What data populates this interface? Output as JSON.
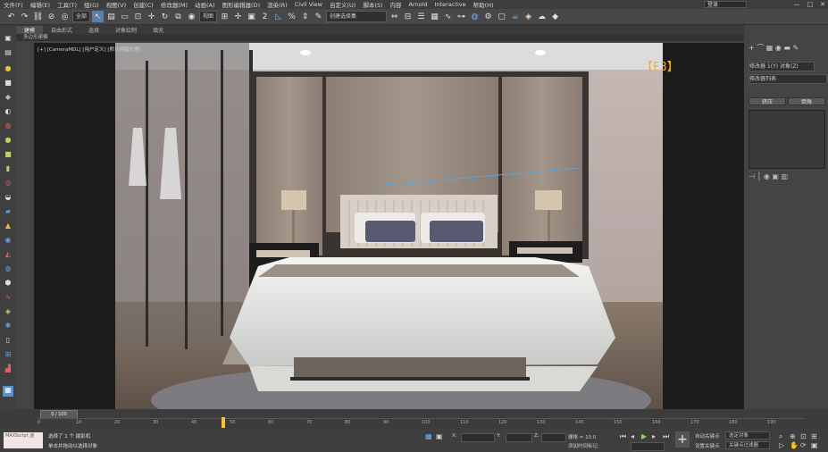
{
  "menu": [
    "文件(F)",
    "编辑(E)",
    "工具(T)",
    "组(G)",
    "视图(V)",
    "创建(C)",
    "修改器(M)",
    "动画(A)",
    "图形编辑器(D)",
    "渲染(R)",
    "Civil View",
    "自定义(U)",
    "脚本(S)",
    "内容",
    "Arnold",
    "Interactive",
    "帮助(H)"
  ],
  "workspace": "登录",
  "window_controls": [
    "—",
    "□",
    "✕"
  ],
  "toolbar": {
    "filter_label": "全部",
    "view_label": "视图",
    "selection_set": "创建选择集",
    "snap_label": "2",
    "percent_label": "%"
  },
  "ribbon_tabs": [
    "建模",
    "自由形式",
    "选择",
    "对象绘制",
    "填充"
  ],
  "ribbon_sub": "多边形建模",
  "viewport": {
    "label": "[+] [CameraMDL] [用户定义] [默认明暗处理]",
    "hotkey_badge": "【F3】"
  },
  "command_panel": {
    "object_name": "修改器 1(Y) 对象(Z)",
    "modifier_list": "修改器列表",
    "btn_left": "挤压",
    "btn_right": "倒角"
  },
  "timeline": {
    "slider_text": "0 / 100",
    "ticks": [
      "0",
      "10",
      "20",
      "30",
      "40",
      "50",
      "60",
      "70",
      "80",
      "90",
      "100",
      "110",
      "120",
      "130",
      "140",
      "150",
      "160",
      "170",
      "180",
      "190"
    ]
  },
  "status": {
    "maxscript": "MAXScript 迷",
    "line1": "选择了 1 个 摄影机",
    "line2": "单击并拖动以选择对象",
    "x_label": "X:",
    "y_label": "Y:",
    "z_label": "Z:",
    "grid_label": "栅格 = 10.0",
    "add_time_tag": "添加时间标记",
    "auto_key": "自动关键点",
    "set_key": "设置关键点",
    "selected_obj": "选定对象",
    "key_filter": "关键点过滤器"
  }
}
